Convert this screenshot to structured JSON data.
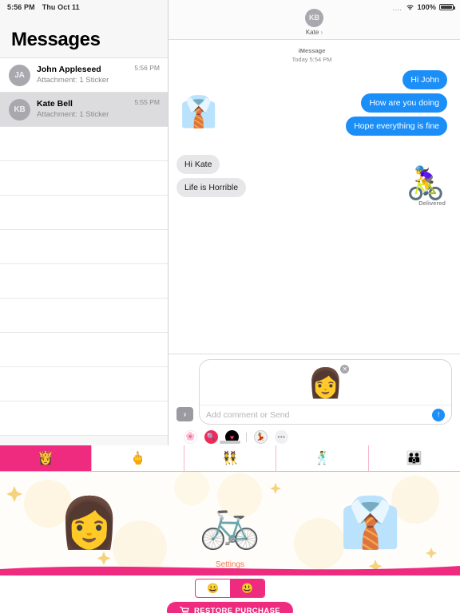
{
  "status_bar": {
    "time": "5:56 PM",
    "date": "Thu Oct 11",
    "signal_dots": "....",
    "wifi_icon": "wifi-icon",
    "battery_percent": "100%",
    "battery_icon": "battery-full-icon"
  },
  "sidebar": {
    "title": "Messages",
    "conversations": [
      {
        "initials": "JA",
        "name": "John Appleseed",
        "preview": "Attachment: 1 Sticker",
        "time": "5:56 PM",
        "selected": false
      },
      {
        "initials": "KB",
        "name": "Kate Bell",
        "preview": "Attachment: 1 Sticker",
        "time": "5:55 PM",
        "selected": true
      }
    ],
    "empty_row_count": 9
  },
  "thread": {
    "header": {
      "initials": "KB",
      "name": "Kate",
      "chevron": "›"
    },
    "stamp_service": "iMessage",
    "stamp_time": "Today 5:54 PM",
    "messages": [
      {
        "text": "Hi John",
        "direction": "out"
      },
      {
        "text": "How are you doing",
        "direction": "out"
      },
      {
        "text": "Hope everything is fine",
        "direction": "out"
      },
      {
        "text": "Hi Kate",
        "direction": "in"
      },
      {
        "text": "Life is Horrible",
        "direction": "in"
      }
    ],
    "incoming_sticker": "👔",
    "outgoing_sticker": "🚴‍♀️",
    "delivered_label": "Delivered"
  },
  "compose": {
    "expand_label": "›",
    "attached_sticker": "👩",
    "remove_label": "✕",
    "placeholder": "Add comment or Send",
    "send_label": "↑",
    "apps": [
      {
        "name": "photos-app-icon",
        "glyph": "🌸"
      },
      {
        "name": "app-store-icon",
        "glyph": "🔍"
      },
      {
        "name": "music-app-icon",
        "glyph": "♥"
      },
      {
        "name": "sticker-app-icon",
        "glyph": "💃"
      },
      {
        "name": "more-apps-icon",
        "glyph": "•••"
      }
    ]
  },
  "sticker_pack": {
    "tabs": [
      {
        "glyph": "👸",
        "active": true
      },
      {
        "glyph": "🖕",
        "active": false
      },
      {
        "glyph": "👯",
        "active": false
      },
      {
        "glyph": "🕺",
        "active": false
      },
      {
        "glyph": "👪",
        "active": false
      }
    ],
    "stickers": [
      {
        "glyph": "👩",
        "name": "woman-sticker"
      },
      {
        "glyph": "🚲",
        "name": "bicycle-sticker"
      },
      {
        "glyph": "👔",
        "name": "suit-sticker"
      }
    ],
    "settings_label": "Settings",
    "toggle": [
      {
        "glyph": "😀",
        "selected": false
      },
      {
        "glyph": "😃",
        "selected": true
      }
    ],
    "restore_label": "RESTORE PURCHASE",
    "cart_icon": "cart-icon"
  },
  "colors": {
    "imessage_blue": "#1b8ef8",
    "pink_accent": "#ef2b7f",
    "received_gray": "#e7e7e9"
  }
}
